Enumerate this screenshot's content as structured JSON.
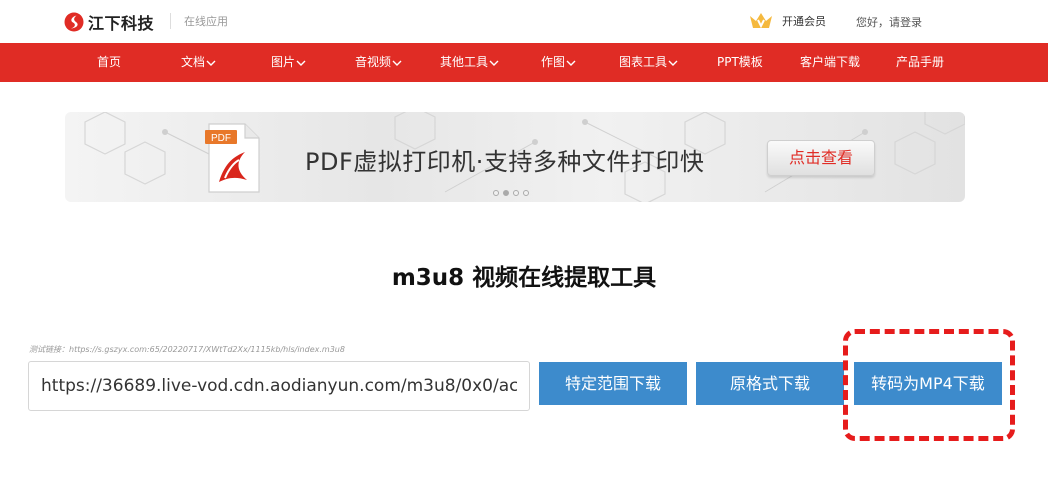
{
  "header": {
    "brand": "江下科技",
    "subtitle": "在线应用",
    "vip_label": "开通会员",
    "login_text": "您好，请登录"
  },
  "nav": {
    "items": [
      {
        "label": "首页",
        "dropdown": false
      },
      {
        "label": "文档",
        "dropdown": true
      },
      {
        "label": "图片",
        "dropdown": true
      },
      {
        "label": "音视频",
        "dropdown": true
      },
      {
        "label": "其他工具",
        "dropdown": true
      },
      {
        "label": "作图",
        "dropdown": true
      },
      {
        "label": "图表工具",
        "dropdown": true
      },
      {
        "label": "PPT模板",
        "dropdown": false
      },
      {
        "label": "客户端下载",
        "dropdown": false
      },
      {
        "label": "产品手册",
        "dropdown": false
      }
    ]
  },
  "banner": {
    "icon_label": "PDF",
    "headline": "PDF虚拟打印机·支持多种文件打印快",
    "cta": "点击查看",
    "slide_count": 4,
    "active_slide": 2
  },
  "tool": {
    "title": "m3u8 视频在线提取工具",
    "test_link": "测试链接：https://s.gszyx.com:65/20220717/XWtTd2Xx/1115kb/hls/index.m3u8",
    "url_value": "https://36689.live-vod.cdn.aodianyun.com/m3u8/0x0/ac",
    "btn_range": "特定范围下载",
    "btn_original": "原格式下载",
    "btn_mp4": "转码为MP4下载"
  },
  "colors": {
    "brand_red": "#e02c25",
    "button_blue": "#3d8bcc",
    "highlight_red": "#e61c1c"
  }
}
